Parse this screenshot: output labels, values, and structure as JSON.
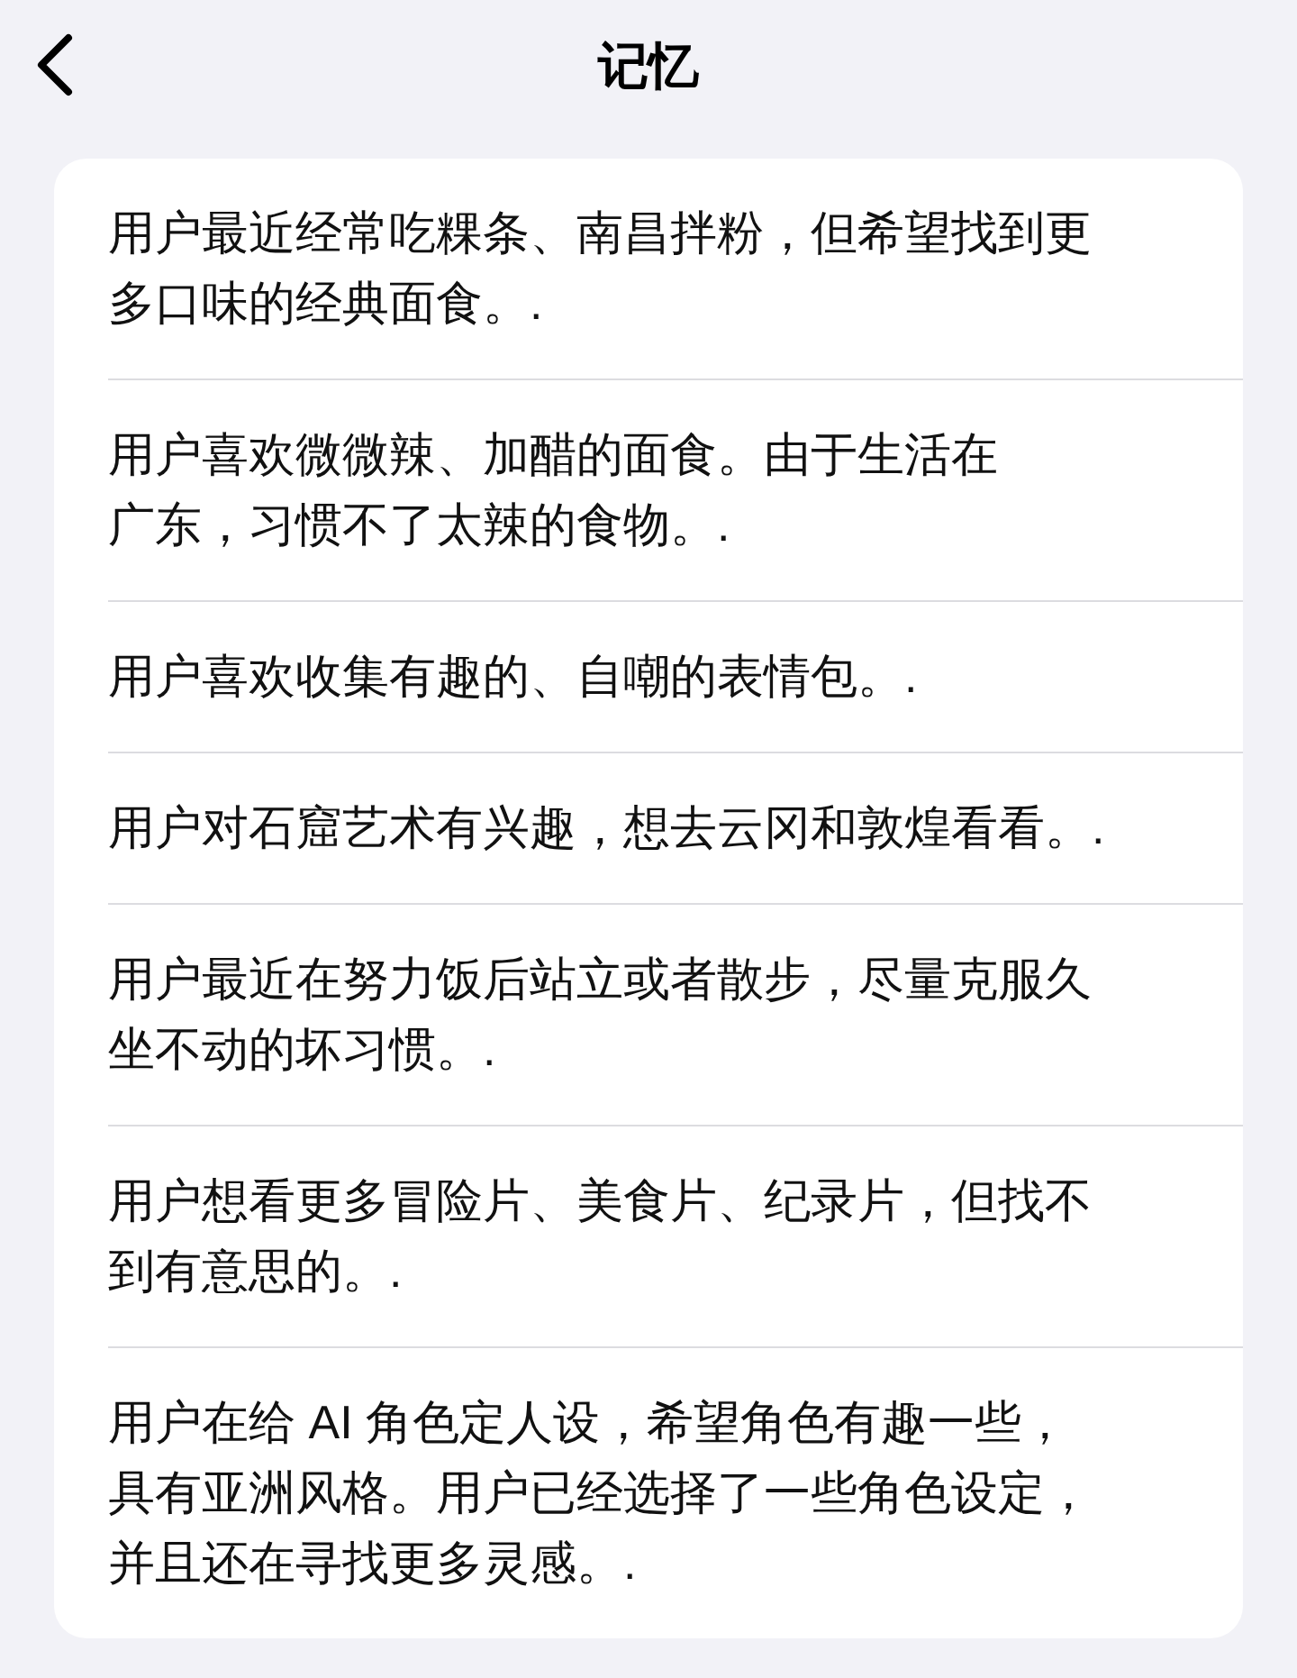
{
  "header": {
    "title": "记忆"
  },
  "memories": [
    {
      "lines": [
        "用户最近经常吃粿条、南昌拌粉，但希望找到更",
        "多口味的经典面食。."
      ]
    },
    {
      "lines": [
        "用户喜欢微微辣、加醋的面食。由于生活在",
        "广东，习惯不了太辣的食物。."
      ]
    },
    {
      "lines": [
        "用户喜欢收集有趣的、自嘲的表情包。."
      ]
    },
    {
      "lines": [
        "用户对石窟艺术有兴趣，想去云冈和敦煌看看。."
      ]
    },
    {
      "lines": [
        "用户最近在努力饭后站立或者散步，尽量克服久",
        "坐不动的坏习惯。."
      ]
    },
    {
      "lines": [
        "用户想看更多冒险片、美食片、纪录片，但找不",
        "到有意思的。."
      ]
    },
    {
      "lines": [
        "用户在给 AI 角色定人设，希望角色有趣一些，",
        "具有亚洲风格。用户已经选择了一些角色设定，",
        "并且还在寻找更多灵感。."
      ]
    }
  ]
}
